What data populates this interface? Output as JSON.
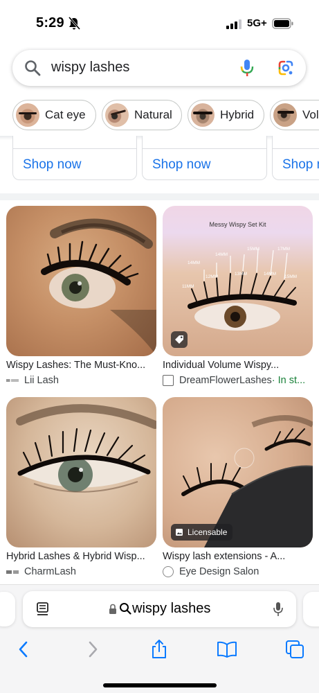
{
  "status_bar": {
    "time": "5:29",
    "network": "5G+"
  },
  "search": {
    "query": "wispy lashes"
  },
  "chips": [
    {
      "label": "Cat eye"
    },
    {
      "label": "Natural"
    },
    {
      "label": "Hybrid"
    },
    {
      "label": "Volu"
    }
  ],
  "shop_cards": [
    {
      "label": "Shop now"
    },
    {
      "label": "Shop now"
    },
    {
      "label": "Shop n"
    }
  ],
  "results": [
    {
      "title": "Wispy Lashes: The Must-Kno...",
      "source": "Lii Lash",
      "extra": ""
    },
    {
      "title": "Individual Volume Wispy...",
      "source": "DreamFlowerLashes",
      "extra": " · In st...",
      "image_text": "Messy Wispy Set Kit",
      "badge_icon": "tag-icon"
    },
    {
      "title": "Hybrid Lashes & Hybrid Wisp...",
      "source": "CharmLash",
      "extra": ""
    },
    {
      "title": "Wispy lash extensions - A...",
      "source": "Eye Design Salon",
      "extra": "",
      "badge": "Licensable"
    }
  ],
  "browser": {
    "address": "wispy lashes"
  },
  "colors": {
    "link_blue": "#1a73e8",
    "stock_green": "#188038",
    "google_blue": "#4285f4",
    "google_red": "#ea4335",
    "google_yellow": "#fbbc04",
    "google_green": "#34a853",
    "ios_blue": "#0a7aff"
  }
}
